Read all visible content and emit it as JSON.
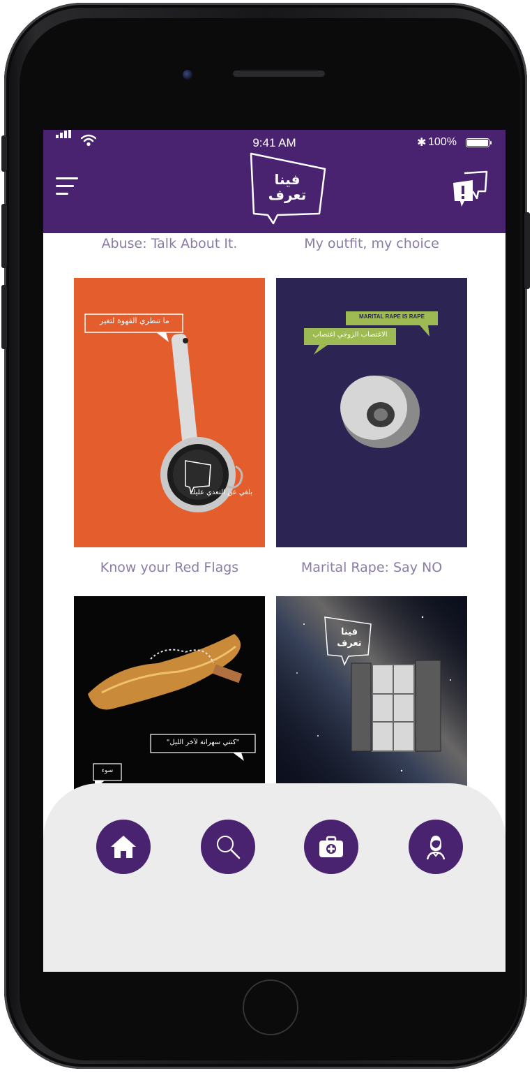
{
  "status_bar": {
    "time": "9:41 AM",
    "battery": "100%"
  },
  "header": {
    "logo_lines": [
      "فينا",
      "تعرف"
    ]
  },
  "campaigns": [
    {
      "title": "Abuse: Talk About It."
    },
    {
      "title": "My outfit, my choice"
    },
    {
      "title": "Know your Red Flags"
    },
    {
      "title": "Marital Rape: Say NO"
    }
  ],
  "posters": [
    {
      "tag": "ما تنطري القهوة لتغير",
      "footer": "بلغي عن التعدي عليك",
      "bg": "#e35d2d"
    },
    {
      "tag_en": "MARITAL RAPE IS RAPE",
      "tag_ar": "الاغتصاب الزوجي اغتصاب",
      "bg": "#2c2554"
    },
    {
      "quote": "\"كنتي سهرانة لآخر الليل\"",
      "badge": "سوء",
      "bg": "#060606"
    },
    {
      "logo_lines": [
        "فينا",
        "تعرف"
      ],
      "bg": "#0b0e1c"
    }
  ],
  "bottom_nav": {
    "items": [
      {
        "icon": "home-icon"
      },
      {
        "icon": "search-icon"
      },
      {
        "icon": "first-aid-icon"
      },
      {
        "icon": "profile-icon"
      }
    ]
  },
  "colors": {
    "brand_purple": "#4a2370",
    "caption": "#8a7ca6",
    "nav_bg": "#ececec"
  }
}
